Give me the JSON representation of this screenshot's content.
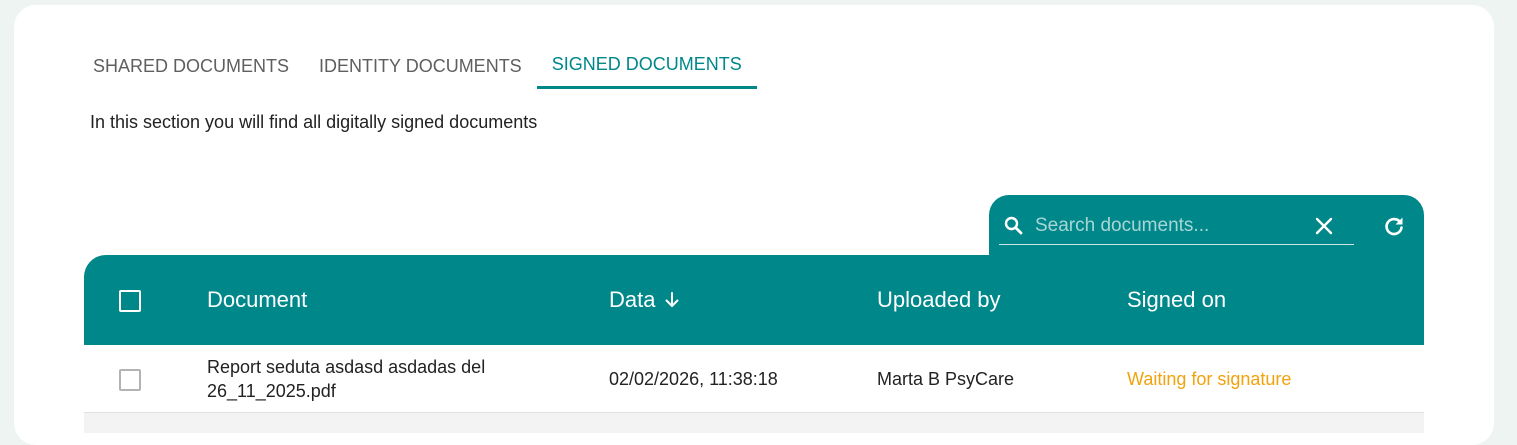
{
  "tabs": [
    {
      "label": "SHARED DOCUMENTS",
      "active": false
    },
    {
      "label": "IDENTITY DOCUMENTS",
      "active": false
    },
    {
      "label": "SIGNED DOCUMENTS",
      "active": true
    }
  ],
  "intro_text": "In this section you will find all digitally signed documents",
  "search": {
    "placeholder": "Search documents...",
    "value": "",
    "icon": "search-icon",
    "clear_icon": "close-icon",
    "refresh_icon": "refresh-icon"
  },
  "table": {
    "columns": {
      "document": "Document",
      "date": "Data",
      "uploaded_by": "Uploaded by",
      "signed_on": "Signed on"
    },
    "sort": {
      "column": "date",
      "direction": "descending",
      "icon": "arrow-down-icon"
    },
    "rows": [
      {
        "document": "Report seduta asdasd asdadas del 26_11_2025.pdf",
        "date": "02/02/2026, 11:38:18",
        "uploaded_by": "Marta B PsyCare",
        "signed_on": "Waiting for signature",
        "checked": false
      }
    ]
  },
  "colors": {
    "accent": "#00878a",
    "pending": "#f2a20c",
    "background": "#eef4f2"
  }
}
